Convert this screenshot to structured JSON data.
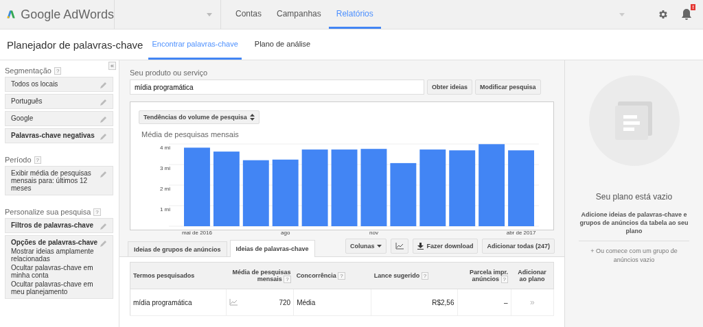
{
  "topbar": {
    "logo": "Google AdWords",
    "nav": [
      {
        "label": "Contas",
        "selected": false
      },
      {
        "label": "Campanhas",
        "selected": false
      },
      {
        "label": "Relatórios",
        "selected": true
      }
    ],
    "notification_badge": "!"
  },
  "header": {
    "title": "Planejador de palavras-chave",
    "tabs": [
      {
        "label": "Encontrar palavras-chave",
        "selected": true
      },
      {
        "label": "Plano de análise",
        "selected": false
      }
    ]
  },
  "sidebar": {
    "collapse": "«",
    "sections": [
      {
        "title": "Segmentação",
        "help": "?",
        "items": [
          {
            "lines": [
              "Todos os locais"
            ],
            "bold": false
          },
          {
            "lines": [
              "Português"
            ],
            "bold": false
          },
          {
            "lines": [
              "Google"
            ],
            "bold": false
          },
          {
            "lines": [
              "Palavras-chave negativas"
            ],
            "bold": true
          }
        ]
      },
      {
        "title": "Período",
        "help": "?",
        "items": [
          {
            "lines": [
              "Exibir média de pesquisas mensais para: últimos 12 meses"
            ],
            "bold": false
          }
        ]
      },
      {
        "title": "Personalize sua pesquisa",
        "help": "?",
        "items": [
          {
            "lines": [
              "Filtros de palavras-chave"
            ],
            "bold": true
          },
          {
            "lines": [
              "Opções de palavras-chave",
              "Mostrar ideias amplamente relacionadas",
              "Ocultar palavras-chave em minha conta",
              "Ocultar palavras-chave em meu planejamento"
            ],
            "bold": true
          }
        ]
      }
    ]
  },
  "search": {
    "label": "Seu produto ou serviço",
    "value": "mídia programática",
    "buttons": [
      "Obter ideias",
      "Modificar pesquisa"
    ]
  },
  "chart": {
    "selector": "Tendências do volume de pesquisa",
    "chart_data": {
      "type": "bar",
      "title": "Média de pesquisas mensais",
      "categories": [
        "mai de 2016",
        null,
        null,
        "ago",
        null,
        null,
        "nov",
        null,
        null,
        null,
        null,
        "abr de 2017"
      ],
      "series": [
        {
          "color": "#4285f4",
          "values": [
            3.82,
            3.63,
            3.21,
            3.24,
            3.73,
            3.73,
            3.76,
            3.07,
            3.73,
            3.69,
            3.99,
            3.69
          ]
        }
      ],
      "ylim": [
        0,
        4
      ],
      "yticks": [
        {
          "value": 1,
          "label": "1 mi"
        },
        {
          "value": 2,
          "label": "2 mi"
        },
        {
          "value": 3,
          "label": "3 mi"
        },
        {
          "value": 4,
          "label": "4 mi"
        }
      ],
      "grid": true
    }
  },
  "results": {
    "tabs": [
      {
        "label": "Ideias de grupos de anúncios",
        "selected": false
      },
      {
        "label": "Ideias de palavras-chave",
        "selected": true
      }
    ],
    "toolbar": {
      "columns": "Colunas",
      "download": "Fazer download",
      "add_all": "Adicionar todas (247)"
    },
    "table": {
      "columns": [
        {
          "label": "Termos pesquisados",
          "help": false
        },
        {
          "label": "Média de pesquisas mensais",
          "help": true
        },
        {
          "label": "Concorrência",
          "help": true
        },
        {
          "label": "Lance sugerido",
          "help": true
        },
        {
          "label": "Parcela impr. anúncios",
          "help": true
        },
        {
          "label": "Adicionar ao plano",
          "help": false
        }
      ],
      "help_mark": "?",
      "rows": [
        {
          "term": "mídia programática",
          "searches": "720",
          "competition": "Média",
          "bid": "R$2,56",
          "share": "–",
          "add": "»"
        }
      ]
    }
  },
  "plan": {
    "title": "Seu plano está vazio",
    "text": "Adicione ideias de palavras-chave e grupos de anúncios da tabela ao seu plano",
    "link": "+ Ou comece com um grupo de anúncios vazio"
  }
}
